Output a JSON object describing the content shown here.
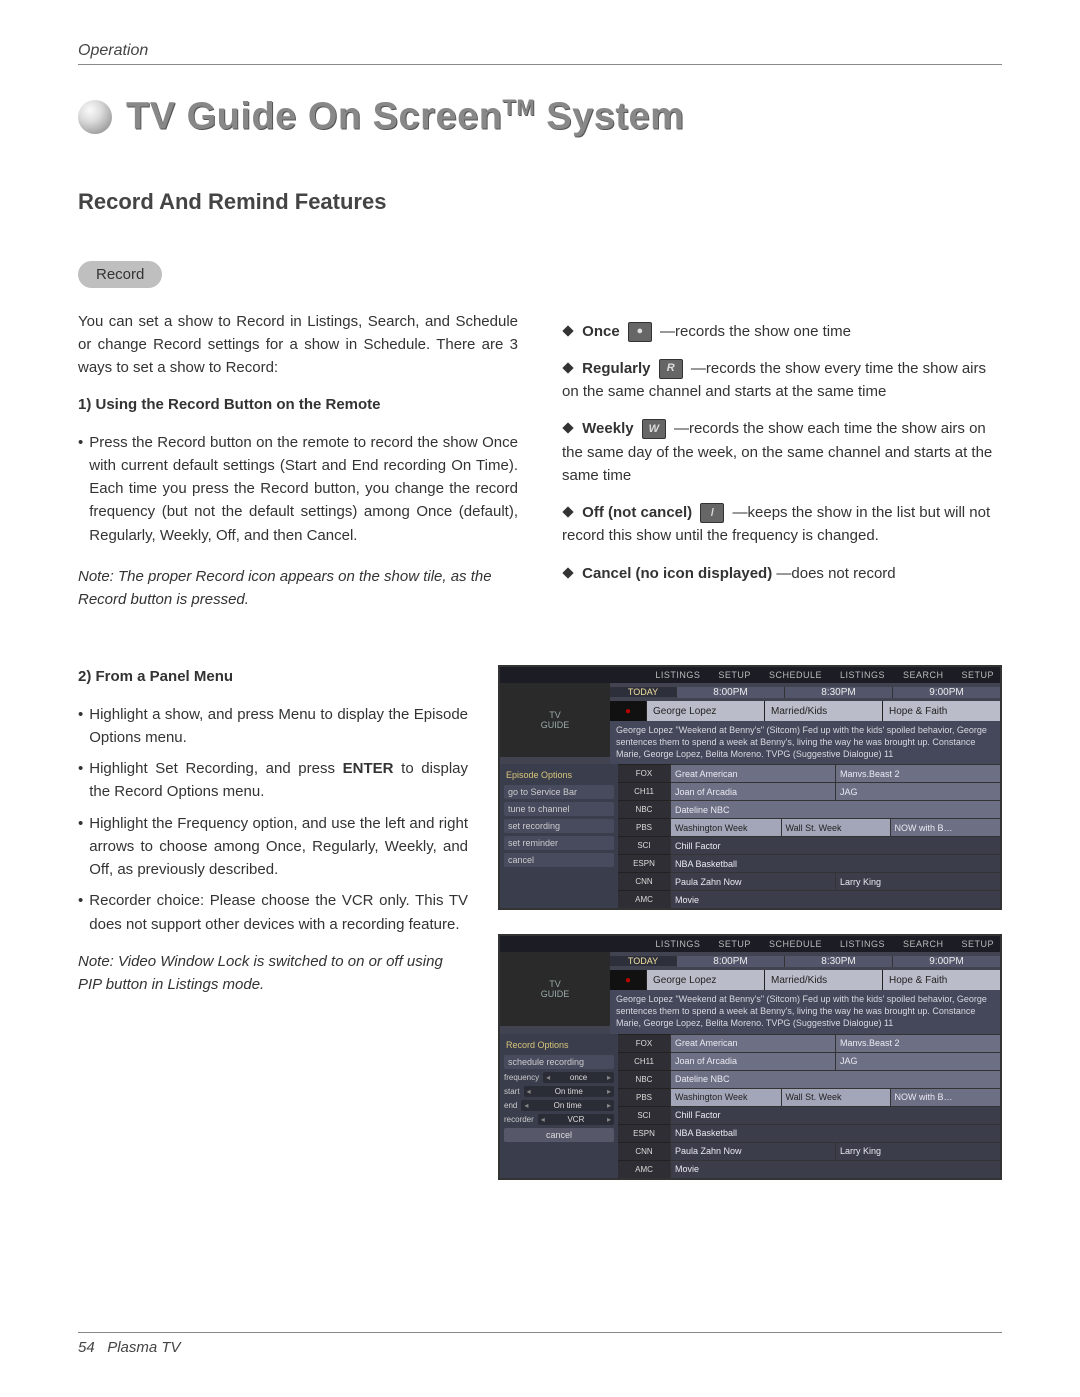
{
  "header": {
    "section_label": "Operation"
  },
  "title": {
    "main": "TV Guide On Screen",
    "tm": "TM",
    "suffix": " System"
  },
  "section": {
    "heading": "Record And Remind Features"
  },
  "record": {
    "pill": "Record",
    "intro": "You can set a show to Record in Listings, Search, and Schedule or change Record settings for a show in Schedule. There are 3 ways to set a show to Record:",
    "method1_head": "1) Using the Record Button on the Remote",
    "method1_para": "Press the Record button on the remote to record the show Once with current default settings (Start and End recording On Time). Each time you press the Record button, you change the record frequency (but not the default settings) among Once (default), Regularly, Weekly, Off, and then Cancel.",
    "method1_note": "Note: The proper Record icon appears on the show tile, as the Record button is pressed.",
    "once": {
      "label": "Once",
      "text": "—records the show one time"
    },
    "regularly": {
      "label": "Regularly",
      "text": "—records the show every time the show airs on the same channel and starts at the same  time"
    },
    "weekly": {
      "label": "Weekly",
      "text": "—records the show each time the show airs on the same day of the week, on the same channel and starts at the same time"
    },
    "off": {
      "label": "Off (not cancel)",
      "text": "—keeps the show in the list but will not record this show until the frequency is changed."
    },
    "cancel": {
      "label": "Cancel (no icon displayed)",
      "text": "—does not record"
    },
    "method2_head": "2) From a Panel Menu",
    "m2_b1": "Highlight a show, and press Menu to display the Episode Options menu.",
    "m2_b2a": "Highlight Set Recording, and press ",
    "m2_b2_enter": "ENTER",
    "m2_b2b": " to display the Record Options menu.",
    "m2_b3": "Highlight the Frequency option, and use the left and right arrows to choose among Once, Regularly, Weekly, and Off, as previously described.",
    "m2_b4": "Recorder choice: Please choose the VCR only. This TV does not support other devices with a recording feature.",
    "m2_note": "Note: Video Window Lock is switched  to on or off using PIP button in Listings mode."
  },
  "guide_common": {
    "tabs": [
      "LISTINGS",
      "SETUP",
      "SCHEDULE",
      "LISTINGS",
      "SEARCH",
      "SETUP"
    ],
    "day": "TODAY",
    "times": [
      "8:00PM",
      "8:30PM",
      "9:00PM"
    ],
    "now_row": [
      "George Lopez",
      "Married/Kids",
      "Hope & Faith"
    ],
    "description": "George Lopez \"Weekend at Benny's\" (Sitcom) Fed up with the kids' spoiled behavior, George sentences them to spend a week at Benny's, living the way he was brought up. Constance Marie, George Lopez, Belita Moreno. TVPG (Suggestive Dialogue) 11",
    "grid": [
      {
        "ch": "FOX",
        "cells": [
          "Great American",
          "",
          "Manvs.Beast 2"
        ]
      },
      {
        "ch": "CH11",
        "cells": [
          "Joan of Arcadia",
          "",
          "JAG"
        ]
      },
      {
        "ch": "NBC",
        "cells": [
          "Dateline NBC",
          "",
          ""
        ]
      },
      {
        "ch": "PBS",
        "cells": [
          "Washington Week",
          "Wall St. Week",
          "NOW with B…"
        ]
      },
      {
        "ch": "SCI",
        "cells": [
          "Chill Factor",
          "",
          ""
        ]
      },
      {
        "ch": "ESPN",
        "cells": [
          "NBA Basketball",
          "",
          ""
        ]
      },
      {
        "ch": "CNN",
        "cells": [
          "Paula Zahn Now",
          "",
          "Larry King"
        ]
      },
      {
        "ch": "AMC",
        "cells": [
          "Movie",
          "",
          ""
        ]
      }
    ]
  },
  "guide1_side": {
    "header": "Episode Options",
    "items": [
      "go to Service Bar",
      "tune to channel",
      "set recording",
      "set reminder",
      "cancel"
    ]
  },
  "guide2_side": {
    "header": "Record Options",
    "schedule": "schedule recording",
    "rows": [
      {
        "label": "frequency",
        "value": "once"
      },
      {
        "label": "start",
        "value": "On time"
      },
      {
        "label": "end",
        "value": "On time"
      },
      {
        "label": "recorder",
        "value": "VCR"
      }
    ],
    "cancel": "cancel"
  },
  "footer": {
    "page": "54",
    "product": "Plasma TV"
  }
}
